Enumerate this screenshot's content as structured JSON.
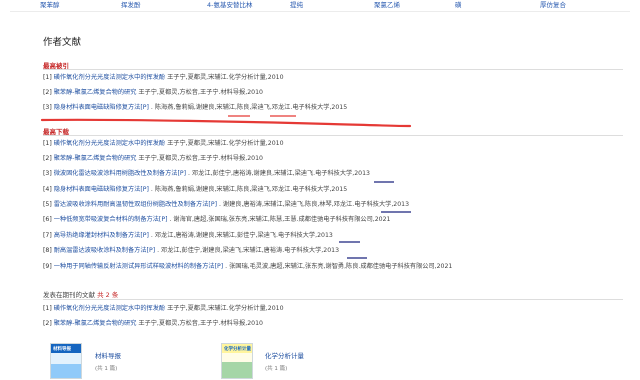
{
  "top_links": [
    "聚苯醇",
    "挥发酚",
    "4-氨基安替比林",
    "提纯",
    "聚氯乙烯",
    "磺",
    "厚仿复合"
  ],
  "section_title": "作者文献",
  "most_cited": {
    "heading": "最高被引",
    "items": [
      {
        "num": "[1]",
        "title": "磺作氧化剂分光光度法测定水中的挥发酚",
        "meta": "王子宁,夏都灵,宋辅江.化学分析计量,2010"
      },
      {
        "num": "[2]",
        "title": "聚苯醇-聚氯乙烯复合物的研究",
        "meta": "王子宁,夏都灵,方松音,王子宁.材料导报,2010"
      },
      {
        "num": "[3]",
        "title": "隐身材料表面电磁缺陷修复方法[P]",
        "meta": ". 陈海燕,鲁莉娟,谢建良,宋辅江,陈良,梁迪飞,邓龙江.电子科技大学,2015"
      }
    ]
  },
  "most_downloaded": {
    "heading": "最高下载",
    "items": [
      {
        "num": "[1]",
        "title": "磺作氧化剂分光光度法测定水中的挥发酚",
        "meta": "王子宁,夏都灵,宋辅江.化学分析计量,2010"
      },
      {
        "num": "[2]",
        "title": "聚苯醇-聚氯乙烯复合物的研究",
        "meta": "王子宁,夏都灵,方松音,王子宁.材料导报,2010"
      },
      {
        "num": "[3]",
        "title": "微波固化雷达吸波涂料用树脂改性及制备方法[P]",
        "meta": ". 邓龙江,彭佳宁,唐裕涛,谢建良,宋辅江,梁迪飞.电子科技大学,2013"
      },
      {
        "num": "[4]",
        "title": "隐身材料表面电磁缺陷修复方法[P]",
        "meta": ". 陈海燕,鲁莉娟,谢建良,宋辅江,陈良,梁迪飞,邓龙江.电子科技大学,2015"
      },
      {
        "num": "[5]",
        "title": "雷达波吸收涂料用耐高温韧性双组份树脂改性及制备方法[P]",
        "meta": ". 谢建良,唐裕涛,宋辅江,梁迪飞,陈良,林琴,邓龙江.电子科技大学,2013"
      },
      {
        "num": "[6]",
        "title": "一种低频宽带吸波复合材料的制备方法[P]",
        "meta": ". 谢海官,唐超,张国瑞,张东亮,宋辅江,陈慧,王慧.成都佳驰电子科技有限公司,2021"
      },
      {
        "num": "[7]",
        "title": "高导热绝缘灌封材料及制备方法[P]",
        "meta": ". 邓龙江,唐裕涛,谢建良,宋辅江,彭佳宁,梁迪飞.电子科技大学,2013"
      },
      {
        "num": "[8]",
        "title": "耐高温雷达波吸收涂料及制备方法[P]",
        "meta": ". 邓龙江,彭佳宁,谢建良,梁迪飞,宋辅江,唐裕涛.电子科技大学,2013"
      },
      {
        "num": "[9]",
        "title": "一种用于同轴传输反射法测试异形试样吸波材料的制备方法[P]",
        "meta": ". 张国瑞,毛灵波,唐超,宋辅江,张东亮,谢智勇,陈良.成都佳驰电子科技有限公司,2021"
      }
    ]
  },
  "journals": {
    "heading_prefix": "发表在期刊的文献",
    "heading_count_label": "共 2 条",
    "items": [
      {
        "num": "[1]",
        "title": "磺作氧化剂分光光度法测定水中的挥发酚",
        "meta": "王子宁,夏都灵,宋辅江.化学分析计量,2010"
      },
      {
        "num": "[2]",
        "title": "聚苯醇-聚氯乙烯复合物的研究",
        "meta": "王子宁,夏都灵,方松音,王子宁.材料导报,2010"
      }
    ],
    "cards": [
      {
        "name": "材料导报",
        "count": "(共 1 篇)",
        "cover_label": "材料导报"
      },
      {
        "name": "化学分析计量",
        "count": "(共 1 篇)",
        "cover_label": "化学分析计量"
      }
    ]
  },
  "colors": {
    "link": "#1f4fa0",
    "heading_red": "#c62828",
    "marker_red": "#e53935",
    "marker_dark": "#1a237e"
  }
}
